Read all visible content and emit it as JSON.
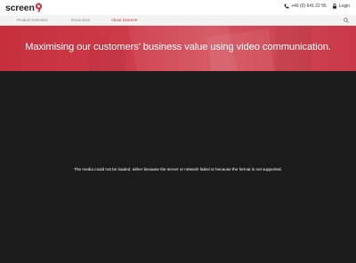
{
  "brand": {
    "logo_text": "screen",
    "logo_mark": "9",
    "accent": "#d2303f"
  },
  "topbar": {
    "phone_icon": "phone-icon",
    "phone": "+46 (0) 641 22 55",
    "login_icon": "lock-icon",
    "login": "Login"
  },
  "nav": {
    "items": [
      {
        "label": "Product Overview"
      },
      {
        "label": "Resources"
      },
      {
        "label": "About Screen9"
      }
    ],
    "active_index": 2,
    "search_icon": "search-icon"
  },
  "hero": {
    "title": "Maximising our customers' business value using video communication.",
    "background": "#c9343f"
  },
  "media": {
    "error_message": "The media could not be loaded, either because the server or network failed or because the format is not supported.",
    "background": "#1b1b1b"
  }
}
